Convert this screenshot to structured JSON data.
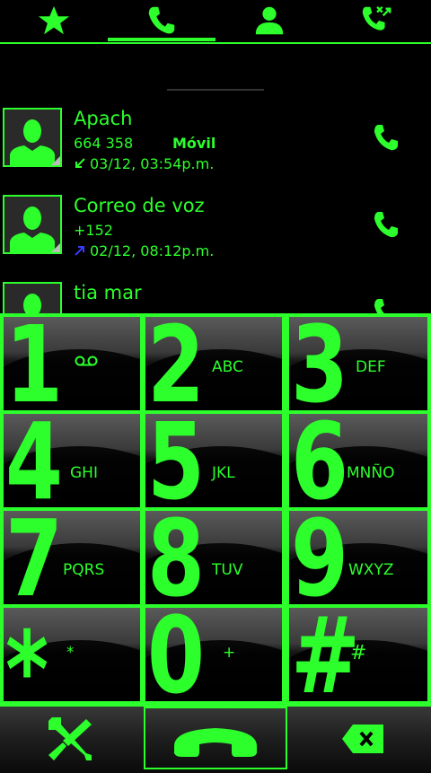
{
  "theme": {
    "accent": "#2cff2c",
    "background": "#000000",
    "outgoing_arrow": "#3a3aff"
  },
  "tabs": [
    {
      "id": "favorites",
      "icon": "star-icon"
    },
    {
      "id": "phone",
      "icon": "phone-icon",
      "active": true
    },
    {
      "id": "contacts",
      "icon": "person-icon"
    },
    {
      "id": "call-log",
      "icon": "call-log-icon"
    }
  ],
  "call_log": [
    {
      "name": "Apach",
      "number": "664 358",
      "type": "Móvil",
      "direction": "incoming",
      "time": "03/12, 03:54p.m."
    },
    {
      "name": "Correo de voz",
      "number": "+152",
      "type": "",
      "direction": "outgoing",
      "time": "02/12, 08:12p.m."
    },
    {
      "name": "tia mar",
      "number": "",
      "type": "",
      "direction": "",
      "time": ""
    }
  ],
  "dialpad": {
    "keys": [
      {
        "digit": "1",
        "letters": "",
        "icon": "voicemail-icon"
      },
      {
        "digit": "2",
        "letters": "ABC"
      },
      {
        "digit": "3",
        "letters": "DEF"
      },
      {
        "digit": "4",
        "letters": "GHI"
      },
      {
        "digit": "5",
        "letters": "JKL"
      },
      {
        "digit": "6",
        "letters": "MNÑO"
      },
      {
        "digit": "7",
        "letters": "PQRS"
      },
      {
        "digit": "8",
        "letters": "TUV"
      },
      {
        "digit": "9",
        "letters": "WXYZ"
      },
      {
        "digit": "*",
        "letters": "*"
      },
      {
        "digit": "0",
        "letters": "+"
      },
      {
        "digit": "#",
        "letters": "#"
      }
    ]
  },
  "bottom_bar": [
    {
      "id": "settings",
      "icon": "tools-icon"
    },
    {
      "id": "call",
      "icon": "handset-icon"
    },
    {
      "id": "delete",
      "icon": "backspace-icon"
    }
  ]
}
